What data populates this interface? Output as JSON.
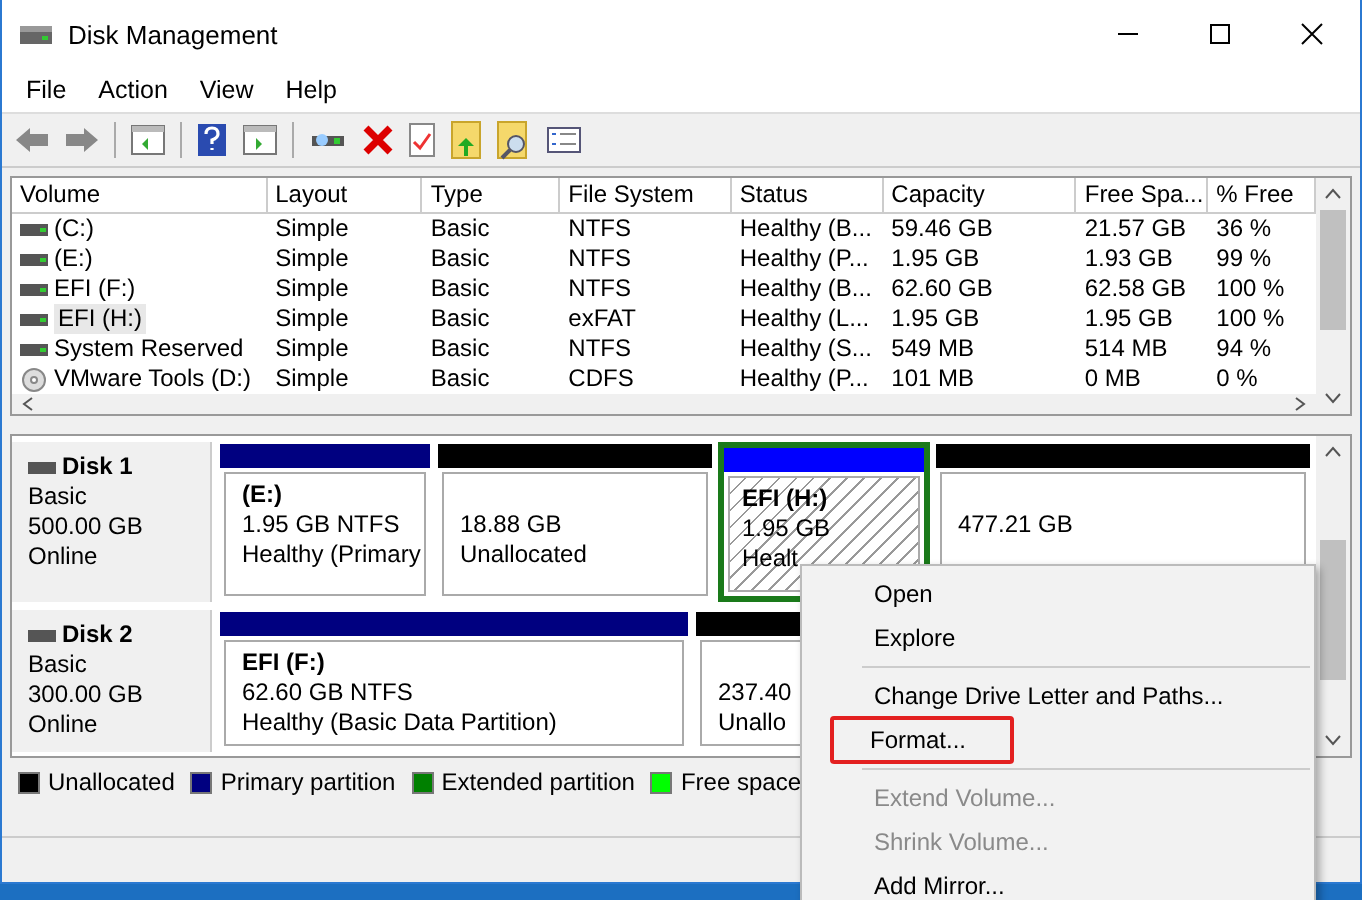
{
  "window": {
    "title": "Disk Management"
  },
  "menu": [
    "File",
    "Action",
    "View",
    "Help"
  ],
  "table": {
    "columns": [
      "Volume",
      "Layout",
      "Type",
      "File System",
      "Status",
      "Capacity",
      "Free Spa...",
      "% Free"
    ],
    "rows": [
      {
        "kind": "disk",
        "selected": false,
        "cells": [
          "(C:)",
          "Simple",
          "Basic",
          "NTFS",
          "Healthy (B...",
          "59.46 GB",
          "21.57 GB",
          "36 %"
        ]
      },
      {
        "kind": "disk",
        "selected": false,
        "cells": [
          "(E:)",
          "Simple",
          "Basic",
          "NTFS",
          "Healthy (P...",
          "1.95 GB",
          "1.93 GB",
          "99 %"
        ]
      },
      {
        "kind": "disk",
        "selected": false,
        "cells": [
          "EFI (F:)",
          "Simple",
          "Basic",
          "NTFS",
          "Healthy (B...",
          "62.60 GB",
          "62.58 GB",
          "100 %"
        ]
      },
      {
        "kind": "disk",
        "selected": true,
        "cells": [
          "EFI (H:)",
          "Simple",
          "Basic",
          "exFAT",
          "Healthy (L...",
          "1.95 GB",
          "1.95 GB",
          "100 %"
        ]
      },
      {
        "kind": "disk",
        "selected": false,
        "cells": [
          "System Reserved",
          "Simple",
          "Basic",
          "NTFS",
          "Healthy (S...",
          "549 MB",
          "514 MB",
          "94 %"
        ]
      },
      {
        "kind": "cd",
        "selected": false,
        "cells": [
          "VMware Tools (D:)",
          "Simple",
          "Basic",
          "CDFS",
          "Healthy (P...",
          "101 MB",
          "0 MB",
          "0 %"
        ]
      }
    ]
  },
  "disks": [
    {
      "name": "Disk 1",
      "type": "Basic",
      "size": "500.00 GB",
      "status": "Online",
      "partitions": [
        {
          "kind": "primary",
          "selected": false,
          "hatched": false,
          "label": "(E:)",
          "size": "1.95 GB NTFS",
          "status": "Healthy (Primary"
        },
        {
          "kind": "unallocated",
          "selected": false,
          "hatched": false,
          "size": "18.88 GB",
          "status": "Unallocated"
        },
        {
          "kind": "logical",
          "selected": true,
          "hatched": true,
          "label": "EFI  (H:)",
          "size": "1.95 GB",
          "status": "Healt"
        },
        {
          "kind": "unallocated",
          "selected": false,
          "hatched": false,
          "size": "477.21 GB"
        }
      ]
    },
    {
      "name": "Disk 2",
      "type": "Basic",
      "size": "300.00 GB",
      "status": "Online",
      "partitions": [
        {
          "kind": "primary",
          "selected": false,
          "hatched": false,
          "label": "EFI  (F:)",
          "size": "62.60 GB NTFS",
          "status": "Healthy (Basic Data Partition)"
        },
        {
          "kind": "unallocated",
          "selected": false,
          "hatched": false,
          "size": "237.40",
          "status": "Unallo"
        }
      ]
    }
  ],
  "legend": [
    {
      "label": "Unallocated",
      "color": "#000000"
    },
    {
      "label": "Primary partition",
      "color": "#000080"
    },
    {
      "label": "Extended partition",
      "color": "#008000"
    },
    {
      "label": "Free space",
      "color": "#00ff00"
    }
  ],
  "context_menu": [
    {
      "kind": "item",
      "label": "Open",
      "disabled": false,
      "highlighted": false
    },
    {
      "kind": "item",
      "label": "Explore",
      "disabled": false,
      "highlighted": false
    },
    {
      "kind": "separator"
    },
    {
      "kind": "item",
      "label": "Change Drive Letter and Paths...",
      "disabled": false,
      "highlighted": false
    },
    {
      "kind": "item",
      "label": "Format...",
      "disabled": false,
      "highlighted": true
    },
    {
      "kind": "separator"
    },
    {
      "kind": "item",
      "label": "Extend Volume...",
      "disabled": true,
      "highlighted": false
    },
    {
      "kind": "item",
      "label": "Shrink Volume...",
      "disabled": true,
      "highlighted": false
    },
    {
      "kind": "item",
      "label": "Add Mirror...",
      "disabled": false,
      "highlighted": false
    }
  ]
}
